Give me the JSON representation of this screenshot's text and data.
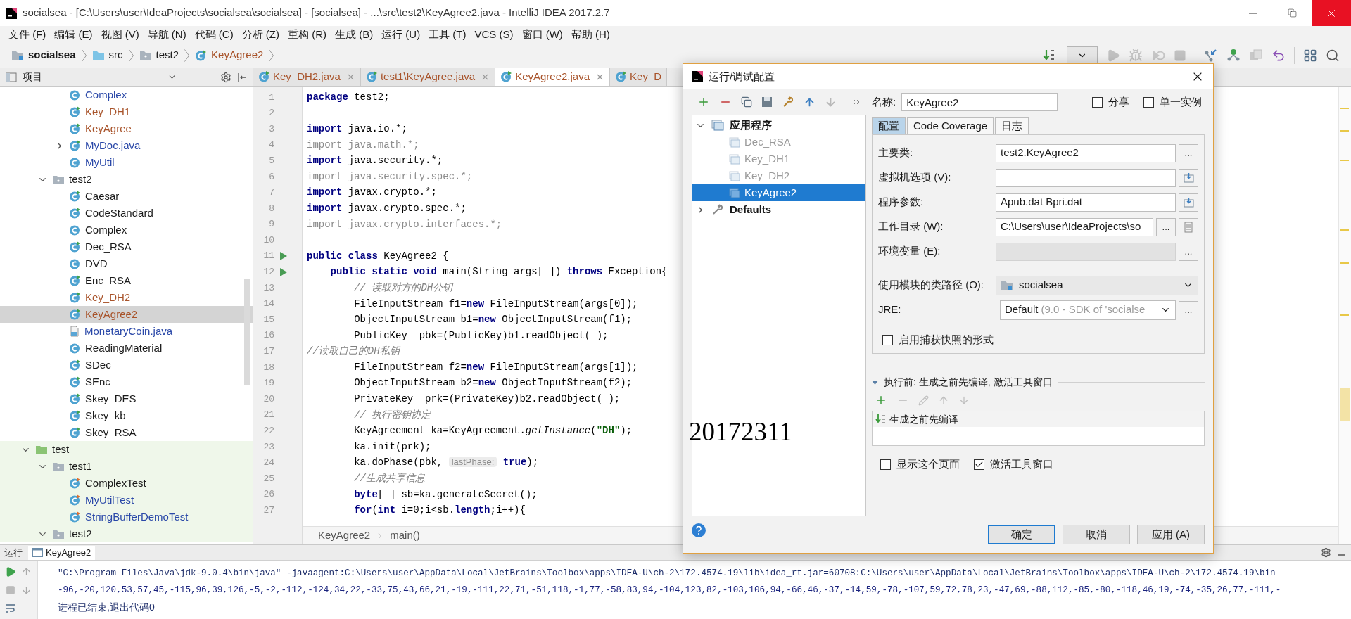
{
  "window": {
    "title": "socialsea - [C:\\Users\\user\\IdeaProjects\\socialsea\\socialsea] - [socialsea] - ...\\src\\test2\\KeyAgree2.java - IntelliJ IDEA 2017.2.7"
  },
  "menu": [
    "文件 (F)",
    "编辑 (E)",
    "视图 (V)",
    "导航 (N)",
    "代码 (C)",
    "分析 (Z)",
    "重构 (R)",
    "生成 (B)",
    "运行 (U)",
    "工具 (T)",
    "VCS (S)",
    "窗口 (W)",
    "帮助 (H)"
  ],
  "breadcrumb": [
    {
      "label": "socialsea",
      "kind": "module"
    },
    {
      "label": "src",
      "kind": "folder"
    },
    {
      "label": "test2",
      "kind": "package"
    },
    {
      "label": "KeyAgree2",
      "kind": "class"
    }
  ],
  "project_panel": {
    "title": "项目",
    "tree": [
      {
        "children": [
          {
            "children": [
              {
                "label": "Complex",
                "kind": "class",
                "color": "#2a48a8",
                "selected": false
              },
              {
                "label": "Key_DH1",
                "kind": "main_class",
                "color": "#a8532a",
                "selected": false
              },
              {
                "label": "KeyAgree",
                "kind": "main_class",
                "color": "#a8532a",
                "selected": false
              },
              {
                "label": "MyDoc.java",
                "kind": "main_class",
                "color": "#2a48a8",
                "expanded": false,
                "selected": false
              },
              {
                "label": "MyUtil",
                "kind": "class",
                "color": "#2a48a8",
                "selected": false
              }
            ]
          },
          {
            "label": "test2",
            "kind": "package",
            "color": "#1a1a1a",
            "expanded": true,
            "selected": false,
            "children": [
              {
                "label": "Caesar",
                "kind": "main_class",
                "color": "#1a1a1a",
                "selected": false
              },
              {
                "label": "CodeStandard",
                "kind": "main_class",
                "color": "#1a1a1a",
                "selected": false
              },
              {
                "label": "Complex",
                "kind": "class",
                "color": "#1a1a1a",
                "selected": false
              },
              {
                "label": "Dec_RSA",
                "kind": "main_class",
                "color": "#1a1a1a",
                "selected": false
              },
              {
                "label": "DVD",
                "kind": "class",
                "color": "#1a1a1a",
                "selected": false
              },
              {
                "label": "Enc_RSA",
                "kind": "main_class",
                "color": "#1a1a1a",
                "selected": false
              },
              {
                "label": "Key_DH2",
                "kind": "main_class",
                "color": "#a8532a",
                "selected": false
              },
              {
                "label": "KeyAgree2",
                "kind": "main_class",
                "color": "#a8532a",
                "selected": true
              },
              {
                "label": "MonetaryCoin.java",
                "kind": "java_file",
                "color": "#2a48a8",
                "selected": false
              },
              {
                "label": "ReadingMaterial",
                "kind": "class",
                "color": "#1a1a1a",
                "selected": false
              },
              {
                "label": "SDec",
                "kind": "main_class",
                "color": "#1a1a1a",
                "selected": false
              },
              {
                "label": "SEnc",
                "kind": "main_class",
                "color": "#1a1a1a",
                "selected": false
              },
              {
                "label": "Skey_DES",
                "kind": "main_class",
                "color": "#1a1a1a",
                "selected": false
              },
              {
                "label": "Skey_kb",
                "kind": "main_class",
                "color": "#1a1a1a",
                "selected": false
              },
              {
                "label": "Skey_RSA",
                "kind": "main_class",
                "color": "#1a1a1a",
                "selected": false
              }
            ]
          }
        ]
      },
      {
        "label": "test",
        "kind": "test_root",
        "color": "#1a1a1a",
        "expanded": true,
        "selected": false,
        "children": [
          {
            "label": "test1",
            "kind": "package",
            "color": "#1a1a1a",
            "expanded": true,
            "selected": false,
            "children": [
              {
                "label": "ComplexTest",
                "kind": "test_class",
                "color": "#1a1a1a",
                "selected": false
              },
              {
                "label": "MyUtilTest",
                "kind": "test_class",
                "color": "#2a48a8",
                "selected": false
              },
              {
                "label": "StringBufferDemoTest",
                "kind": "test_class",
                "color": "#2a48a8",
                "selected": false
              }
            ]
          },
          {
            "label": "test2",
            "kind": "package",
            "color": "#1a1a1a",
            "expanded": true,
            "selected": false
          }
        ]
      }
    ]
  },
  "editor": {
    "tabs": [
      {
        "label": "Key_DH2.java",
        "selected": false,
        "color": "#a8532a"
      },
      {
        "label": "test1\\KeyAgree.java",
        "selected": false,
        "color": "#a8532a"
      },
      {
        "label": "KeyAgree2.java",
        "selected": true,
        "color": "#a8532a"
      },
      {
        "label": "Key_D",
        "selected": false,
        "color": "#a8532a"
      }
    ],
    "lines": [
      {
        "number": "1",
        "run": false,
        "segments": [
          {
            "kind": "keyword",
            "text": "package"
          },
          {
            "kind": "plain",
            "text": " test2;"
          }
        ]
      },
      {
        "number": "2",
        "run": false
      },
      {
        "number": "3",
        "run": false,
        "segments": [
          {
            "kind": "keyword",
            "text": "import"
          },
          {
            "kind": "plain",
            "text": " java.io.*;"
          }
        ]
      },
      {
        "number": "4",
        "run": false,
        "segments": [
          {
            "kind": "unused",
            "text": "import java.math.*;"
          }
        ]
      },
      {
        "number": "5",
        "run": false,
        "segments": [
          {
            "kind": "keyword",
            "text": "import"
          },
          {
            "kind": "plain",
            "text": " java.security.*;"
          }
        ]
      },
      {
        "number": "6",
        "run": false,
        "segments": [
          {
            "kind": "unused",
            "text": "import java.security.spec.*;"
          }
        ]
      },
      {
        "number": "7",
        "run": false,
        "segments": [
          {
            "kind": "keyword",
            "text": "import"
          },
          {
            "kind": "plain",
            "text": " javax.crypto.*;"
          }
        ]
      },
      {
        "number": "8",
        "run": false,
        "segments": [
          {
            "kind": "keyword",
            "text": "import"
          },
          {
            "kind": "plain",
            "text": " javax.crypto.spec.*;"
          }
        ]
      },
      {
        "number": "9",
        "run": false,
        "segments": [
          {
            "kind": "unused",
            "text": "import javax.crypto.interfaces.*;"
          }
        ]
      },
      {
        "number": "10",
        "run": false
      },
      {
        "number": "11",
        "run": true,
        "segments": [
          {
            "kind": "keyword",
            "text": "public class"
          },
          {
            "kind": "plain",
            "text": " KeyAgree2 {"
          }
        ]
      },
      {
        "number": "12",
        "run": true,
        "segments": [
          {
            "kind": "keyword",
            "text": "    public static void"
          },
          {
            "kind": "plain",
            "text": " main(String args[ ]) "
          },
          {
            "kind": "keyword",
            "text": "throws"
          },
          {
            "kind": "plain",
            "text": " Exception{"
          }
        ]
      },
      {
        "number": "13",
        "run": false,
        "segments": [
          {
            "kind": "comment",
            "text": "        // 读取对方的DH公钥"
          }
        ]
      },
      {
        "number": "14",
        "run": false,
        "segments": [
          {
            "kind": "plain",
            "text": "        FileInputStream f1="
          },
          {
            "kind": "keyword",
            "text": "new"
          },
          {
            "kind": "plain",
            "text": " FileInputStream(args[0]);"
          }
        ]
      },
      {
        "number": "15",
        "run": false,
        "segments": [
          {
            "kind": "plain",
            "text": "        ObjectInputStream b1="
          },
          {
            "kind": "keyword",
            "text": "new"
          },
          {
            "kind": "plain",
            "text": " ObjectInputStream(f1);"
          }
        ]
      },
      {
        "number": "16",
        "run": false,
        "segments": [
          {
            "kind": "plain",
            "text": "        PublicKey  pbk=(PublicKey)b1.readObject( );"
          }
        ]
      },
      {
        "number": "17",
        "run": false,
        "segments": [
          {
            "kind": "comment",
            "text": "//读取自己的DH私钥"
          }
        ]
      },
      {
        "number": "18",
        "run": false,
        "segments": [
          {
            "kind": "plain",
            "text": "        FileInputStream f2="
          },
          {
            "kind": "keyword",
            "text": "new"
          },
          {
            "kind": "plain",
            "text": " FileInputStream(args[1]);"
          }
        ]
      },
      {
        "number": "19",
        "run": false,
        "segments": [
          {
            "kind": "plain",
            "text": "        ObjectInputStream b2="
          },
          {
            "kind": "keyword",
            "text": "new"
          },
          {
            "kind": "plain",
            "text": " ObjectInputStream(f2);"
          }
        ]
      },
      {
        "number": "20",
        "run": false,
        "segments": [
          {
            "kind": "plain",
            "text": "        PrivateKey  prk=(PrivateKey)b2.readObject( );"
          }
        ]
      },
      {
        "number": "21",
        "run": false,
        "segments": [
          {
            "kind": "comment",
            "text": "        // 执行密钥协定"
          }
        ]
      },
      {
        "number": "22",
        "run": false,
        "segments": [
          {
            "kind": "plain",
            "text": "        KeyAgreement ka=KeyAgreement."
          },
          {
            "kind": "italic",
            "text": "getInstance"
          },
          {
            "kind": "plain",
            "text": "("
          },
          {
            "kind": "string",
            "text": "\"DH\""
          },
          {
            "kind": "plain",
            "text": ");"
          }
        ]
      },
      {
        "number": "23",
        "run": false,
        "segments": [
          {
            "kind": "plain",
            "text": "        ka.init(prk);"
          }
        ]
      },
      {
        "number": "24",
        "run": false,
        "segments": [
          {
            "kind": "plain",
            "text": "        ka.doPhase(pbk, "
          },
          {
            "kind": "hint",
            "text": "lastPhase:"
          },
          {
            "kind": "keyword",
            "text": " true"
          },
          {
            "kind": "plain",
            "text": ");"
          }
        ]
      },
      {
        "number": "25",
        "run": false,
        "segments": [
          {
            "kind": "comment",
            "text": "        //生成共享信息"
          }
        ]
      },
      {
        "number": "26",
        "run": false,
        "segments": [
          {
            "kind": "keyword",
            "text": "        byte"
          },
          {
            "kind": "plain",
            "text": "[ ] sb=ka.generateSecret();"
          }
        ]
      },
      {
        "number": "27",
        "run": false,
        "segments": [
          {
            "kind": "keyword",
            "text": "        for"
          },
          {
            "kind": "plain",
            "text": "("
          },
          {
            "kind": "keyword",
            "text": "int"
          },
          {
            "kind": "plain",
            "text": " i=0;i<sb."
          },
          {
            "kind": "keyword",
            "text": "length"
          },
          {
            "kind": "plain",
            "text": ";i++){"
          }
        ]
      }
    ],
    "breadcrumb": [
      "KeyAgree2",
      "main()"
    ]
  },
  "dialog": {
    "title": "运行/调试配置",
    "tree": [
      {
        "label": "应用程序",
        "kind": "group",
        "expanded": true,
        "selected": false,
        "children": [
          {
            "label": "Dec_RSA",
            "kind": "config",
            "selected": false
          },
          {
            "label": "Key_DH1",
            "kind": "config",
            "selected": false
          },
          {
            "label": "Key_DH2",
            "kind": "config",
            "selected": false
          },
          {
            "label": "KeyAgree2",
            "kind": "config",
            "selected": true
          }
        ]
      },
      {
        "label": "Defaults",
        "kind": "defaults",
        "expanded": false,
        "selected": false
      }
    ],
    "name_label": "名称:",
    "name_value": "KeyAgree2",
    "header_checks": [
      {
        "label": "分享",
        "checked": false
      },
      {
        "label": "单一实例",
        "checked": false
      }
    ],
    "tabs": [
      {
        "label": "配置",
        "selected": true
      },
      {
        "label": "Code Coverage",
        "selected": false
      },
      {
        "label": "日志",
        "selected": false
      }
    ],
    "fields": [
      {
        "label": "主要类:",
        "kind": "text",
        "value": "test2.KeyAgree2",
        "disabled": false,
        "buttons": [
          {
            "kind": "browse",
            "label": "..."
          }
        ]
      },
      {
        "label": "虚拟机选项 (V):",
        "kind": "text",
        "disabled": false,
        "buttons": [
          {
            "kind": "expand"
          }
        ]
      },
      {
        "label": "程序参数:",
        "kind": "text",
        "value": "Apub.dat Bpri.dat",
        "disabled": false,
        "buttons": [
          {
            "kind": "expand"
          }
        ]
      },
      {
        "label": "工作目录 (W):",
        "kind": "text",
        "value": "C:\\Users\\user\\IdeaProjects\\so",
        "disabled": false,
        "buttons": [
          {
            "kind": "browse",
            "label": "..."
          },
          {
            "kind": "macro"
          }
        ]
      },
      {
        "label": "环境变量 (E):",
        "kind": "text",
        "disabled": true,
        "buttons": [
          {
            "kind": "browse",
            "label": "..."
          }
        ]
      },
      {
        "label": "使用模块的类路径 (O):",
        "kind": "module_select",
        "value": "socialsea"
      },
      {
        "label": "JRE:",
        "kind": "jre_select",
        "value": "Default",
        "detail": "(9.0 - SDK of 'socialse",
        "buttons": [
          {
            "kind": "browse",
            "label": "..."
          }
        ]
      }
    ],
    "snapshot_check": {
      "label": "启用捕获快照的形式",
      "checked": false
    },
    "before_launch": {
      "title": "执行前: 生成之前先编译, 激活工具窗口",
      "expanded": true,
      "tasks": [
        "生成之前先编译"
      ]
    },
    "footer_checks": [
      {
        "label": "显示这个页面",
        "checked": false
      },
      {
        "label": "激活工具窗口",
        "checked": true
      }
    ],
    "buttons": [
      {
        "label": "确定",
        "default": true
      },
      {
        "label": "取消",
        "default": false
      },
      {
        "label": "应用 (A)",
        "default": false
      }
    ],
    "annotation": "20172311"
  },
  "run_panel": {
    "title": "运行",
    "tab": "KeyAgree2",
    "console": [
      {
        "kind": "command",
        "text": "\"C:\\Program Files\\Java\\jdk-9.0.4\\bin\\java\" -javaagent:C:\\Users\\user\\AppData\\Local\\JetBrains\\Toolbox\\apps\\IDEA-U\\ch-2\\172.4574.19\\lib\\idea_rt.jar=60708:C:\\Users\\user\\AppData\\Local\\JetBrains\\Toolbox\\apps\\IDEA-U\\ch-2\\172.4574.19\\bin"
      },
      {
        "kind": "output",
        "text": "-96,-20,120,53,57,45,-115,96,39,126,-5,-2,-112,-124,34,22,-33,75,43,66,21,-19,-111,22,71,-51,118,-1,77,-58,83,94,-104,123,82,-103,106,94,-66,46,-37,-14,59,-78,-107,59,72,78,23,-47,69,-88,112,-85,-80,-118,46,19,-74,-35,26,77,-111,-"
      },
      {
        "kind": "status",
        "text": "进程已结束,退出代码0"
      }
    ]
  }
}
